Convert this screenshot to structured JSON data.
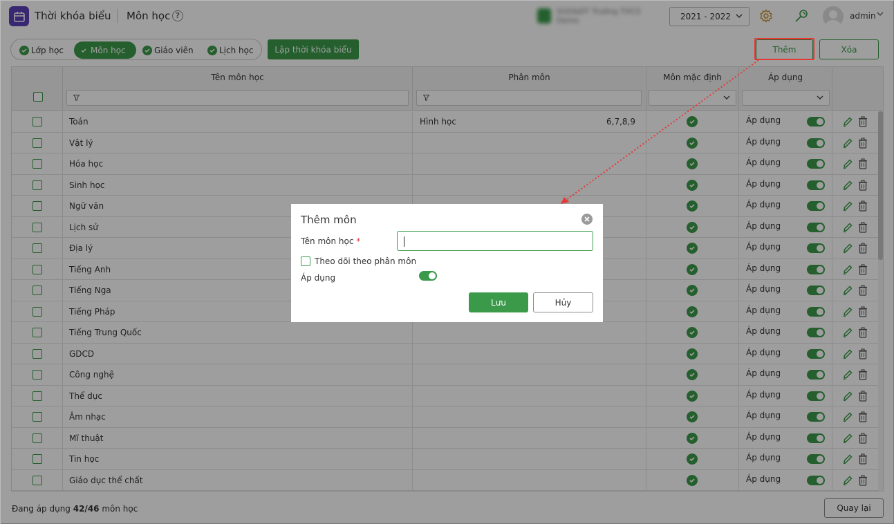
{
  "header": {
    "app_title": "Thời khóa biểu",
    "page_title": "Môn học",
    "help_symbol": "?",
    "school_name": "SGD&ĐT Trường THCS Demo",
    "school_year": "2021 - 2022",
    "username": "admin"
  },
  "toolbar": {
    "filters": [
      {
        "label": "Lớp học",
        "active": false
      },
      {
        "label": "Môn học",
        "active": true
      },
      {
        "label": "Giáo viên",
        "active": false
      },
      {
        "label": "Lịch học",
        "active": false
      }
    ],
    "build_schedule_label": "Lập thời khóa biểu",
    "add_label": "Thêm",
    "delete_label": "Xóa"
  },
  "table": {
    "columns": [
      "Tên môn học",
      "Phân môn",
      "Môn mặc định",
      "Áp dụng"
    ],
    "rows": [
      {
        "name": "Toán",
        "sub": "Hình học",
        "grades": "6,7,8,9",
        "default": true,
        "apply": "Áp dụng"
      },
      {
        "name": "Vật lý",
        "sub": "",
        "grades": "",
        "default": true,
        "apply": "Áp dụng"
      },
      {
        "name": "Hóa học",
        "sub": "",
        "grades": "",
        "default": true,
        "apply": "Áp dụng"
      },
      {
        "name": "Sinh học",
        "sub": "",
        "grades": "",
        "default": true,
        "apply": "Áp dụng"
      },
      {
        "name": "Ngữ văn",
        "sub": "",
        "grades": "",
        "default": true,
        "apply": "Áp dụng"
      },
      {
        "name": "Lịch sử",
        "sub": "",
        "grades": "",
        "default": true,
        "apply": "Áp dụng"
      },
      {
        "name": "Địa lý",
        "sub": "",
        "grades": "",
        "default": true,
        "apply": "Áp dụng"
      },
      {
        "name": "Tiếng Anh",
        "sub": "",
        "grades": "",
        "default": true,
        "apply": "Áp dụng"
      },
      {
        "name": "Tiếng Nga",
        "sub": "",
        "grades": "",
        "default": true,
        "apply": "Áp dụng"
      },
      {
        "name": "Tiếng Pháp",
        "sub": "",
        "grades": "",
        "default": true,
        "apply": "Áp dụng"
      },
      {
        "name": "Tiếng Trung Quốc",
        "sub": "",
        "grades": "",
        "default": true,
        "apply": "Áp dụng"
      },
      {
        "name": "GDCD",
        "sub": "",
        "grades": "",
        "default": true,
        "apply": "Áp dụng"
      },
      {
        "name": "Công nghệ",
        "sub": "",
        "grades": "",
        "default": true,
        "apply": "Áp dụng"
      },
      {
        "name": "Thể dục",
        "sub": "",
        "grades": "",
        "default": true,
        "apply": "Áp dụng"
      },
      {
        "name": "Âm nhạc",
        "sub": "",
        "grades": "",
        "default": true,
        "apply": "Áp dụng"
      },
      {
        "name": "Mĩ thuật",
        "sub": "",
        "grades": "",
        "default": true,
        "apply": "Áp dụng"
      },
      {
        "name": "Tin học",
        "sub": "",
        "grades": "",
        "default": true,
        "apply": "Áp dụng"
      },
      {
        "name": "Giáo dục thể chất",
        "sub": "",
        "grades": "",
        "default": true,
        "apply": "Áp dụng"
      }
    ]
  },
  "footer": {
    "status_prefix": "Đang áp dụng ",
    "status_count": "42/46",
    "status_suffix": " môn học",
    "back_label": "Quay lại"
  },
  "modal": {
    "title": "Thêm môn",
    "name_label": "Tên môn học",
    "required_mark": "*",
    "name_value": "",
    "track_label": "Theo dõi theo phân môn",
    "apply_label": "Áp dụng",
    "apply_on": true,
    "save_label": "Lưu",
    "cancel_label": "Hủy"
  },
  "colors": {
    "brand_green": "#3a9a4a",
    "logo_purple": "#5b3fb6",
    "highlight_red": "#e53935"
  }
}
